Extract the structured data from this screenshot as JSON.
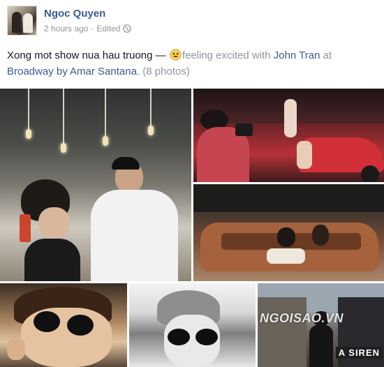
{
  "post": {
    "author": "Ngoc Quyen",
    "time": "2 hours ago",
    "separator": "·",
    "edited": "Edited",
    "privacy_icon": "globe-icon",
    "text_main": "Xong mot show nua hau truong — ",
    "emoji_icon": "smiley-excited-icon",
    "feeling": "feeling excited",
    "with_word": " with ",
    "tagged_person": "John Tran",
    "at_word": " at ",
    "place": "Broadway by Amar Santana",
    "photo_count": ". (8 photos)"
  },
  "photos": {
    "watermark": "NGOISAO.VN",
    "sign_text": "A SIREN"
  },
  "colors": {
    "link": "#3b5998",
    "muted": "#90949c",
    "text": "#141823"
  }
}
